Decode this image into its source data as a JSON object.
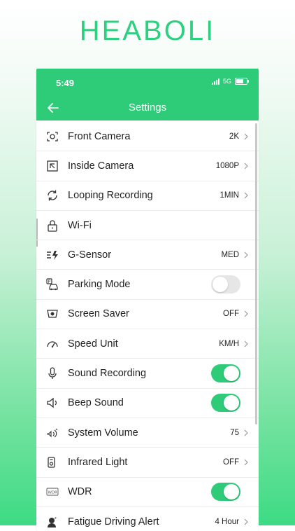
{
  "brand": "HEABOLI",
  "status": {
    "time": "5:49",
    "network": "5G"
  },
  "header": {
    "title": "Settings",
    "back_icon": "back-arrow-icon"
  },
  "colors": {
    "accent": "#2ecc78",
    "text": "#222222"
  },
  "settings": [
    {
      "label": "Front Camera",
      "value": "2K",
      "control": "chevron",
      "icon": "front-camera-icon"
    },
    {
      "label": "Inside Camera",
      "value": "1080P",
      "control": "chevron",
      "icon": "inside-camera-icon"
    },
    {
      "label": "Looping Recording",
      "value": "1MIN",
      "control": "chevron",
      "icon": "loop-icon"
    },
    {
      "label": "Wi-Fi",
      "value": "",
      "control": "none",
      "icon": "lock-icon"
    },
    {
      "label": "G-Sensor",
      "value": "MED",
      "control": "chevron",
      "icon": "g-sensor-icon"
    },
    {
      "label": "Parking Mode",
      "value": "",
      "control": "toggle",
      "on": false,
      "icon": "parking-icon"
    },
    {
      "label": "Screen Saver",
      "value": "OFF",
      "control": "chevron",
      "icon": "screen-saver-icon"
    },
    {
      "label": "Speed Unit",
      "value": "KM/H",
      "control": "chevron",
      "icon": "speedometer-icon"
    },
    {
      "label": "Sound Recording",
      "value": "",
      "control": "toggle",
      "on": true,
      "icon": "microphone-icon"
    },
    {
      "label": "Beep Sound",
      "value": "",
      "control": "toggle",
      "on": true,
      "icon": "speaker-icon"
    },
    {
      "label": "System Volume",
      "value": "75",
      "control": "chevron",
      "icon": "volume-icon"
    },
    {
      "label": "Infrared Light",
      "value": "OFF",
      "control": "chevron",
      "icon": "infrared-icon"
    },
    {
      "label": "WDR",
      "value": "",
      "control": "toggle",
      "on": true,
      "icon": "wdr-icon"
    },
    {
      "label": "Fatigue Driving Alert",
      "value": "4 Hour",
      "control": "chevron",
      "icon": "fatigue-icon"
    }
  ]
}
